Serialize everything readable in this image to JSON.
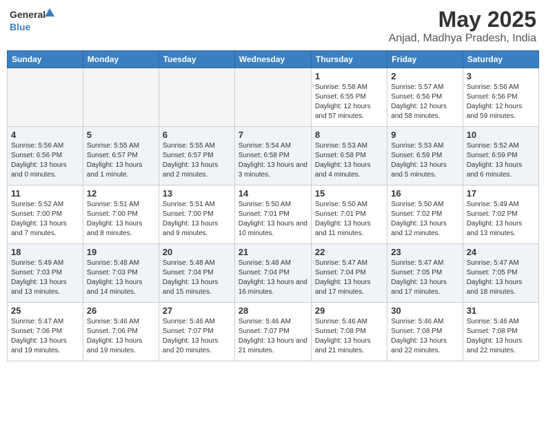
{
  "logo": {
    "general": "General",
    "blue": "Blue"
  },
  "header": {
    "month_year": "May 2025",
    "location": "Anjad, Madhya Pradesh, India"
  },
  "weekdays": [
    "Sunday",
    "Monday",
    "Tuesday",
    "Wednesday",
    "Thursday",
    "Friday",
    "Saturday"
  ],
  "weeks": [
    {
      "days": [
        {
          "num": "",
          "detail": ""
        },
        {
          "num": "",
          "detail": ""
        },
        {
          "num": "",
          "detail": ""
        },
        {
          "num": "",
          "detail": ""
        },
        {
          "num": "1",
          "detail": "Sunrise: 5:58 AM\nSunset: 6:55 PM\nDaylight: 12 hours\nand 57 minutes."
        },
        {
          "num": "2",
          "detail": "Sunrise: 5:57 AM\nSunset: 6:56 PM\nDaylight: 12 hours\nand 58 minutes."
        },
        {
          "num": "3",
          "detail": "Sunrise: 5:56 AM\nSunset: 6:56 PM\nDaylight: 12 hours\nand 59 minutes."
        }
      ]
    },
    {
      "days": [
        {
          "num": "4",
          "detail": "Sunrise: 5:56 AM\nSunset: 6:56 PM\nDaylight: 13 hours\nand 0 minutes."
        },
        {
          "num": "5",
          "detail": "Sunrise: 5:55 AM\nSunset: 6:57 PM\nDaylight: 13 hours\nand 1 minute."
        },
        {
          "num": "6",
          "detail": "Sunrise: 5:55 AM\nSunset: 6:57 PM\nDaylight: 13 hours\nand 2 minutes."
        },
        {
          "num": "7",
          "detail": "Sunrise: 5:54 AM\nSunset: 6:58 PM\nDaylight: 13 hours\nand 3 minutes."
        },
        {
          "num": "8",
          "detail": "Sunrise: 5:53 AM\nSunset: 6:58 PM\nDaylight: 13 hours\nand 4 minutes."
        },
        {
          "num": "9",
          "detail": "Sunrise: 5:53 AM\nSunset: 6:59 PM\nDaylight: 13 hours\nand 5 minutes."
        },
        {
          "num": "10",
          "detail": "Sunrise: 5:52 AM\nSunset: 6:59 PM\nDaylight: 13 hours\nand 6 minutes."
        }
      ]
    },
    {
      "days": [
        {
          "num": "11",
          "detail": "Sunrise: 5:52 AM\nSunset: 7:00 PM\nDaylight: 13 hours\nand 7 minutes."
        },
        {
          "num": "12",
          "detail": "Sunrise: 5:51 AM\nSunset: 7:00 PM\nDaylight: 13 hours\nand 8 minutes."
        },
        {
          "num": "13",
          "detail": "Sunrise: 5:51 AM\nSunset: 7:00 PM\nDaylight: 13 hours\nand 9 minutes."
        },
        {
          "num": "14",
          "detail": "Sunrise: 5:50 AM\nSunset: 7:01 PM\nDaylight: 13 hours\nand 10 minutes."
        },
        {
          "num": "15",
          "detail": "Sunrise: 5:50 AM\nSunset: 7:01 PM\nDaylight: 13 hours\nand 11 minutes."
        },
        {
          "num": "16",
          "detail": "Sunrise: 5:50 AM\nSunset: 7:02 PM\nDaylight: 13 hours\nand 12 minutes."
        },
        {
          "num": "17",
          "detail": "Sunrise: 5:49 AM\nSunset: 7:02 PM\nDaylight: 13 hours\nand 13 minutes."
        }
      ]
    },
    {
      "days": [
        {
          "num": "18",
          "detail": "Sunrise: 5:49 AM\nSunset: 7:03 PM\nDaylight: 13 hours\nand 13 minutes."
        },
        {
          "num": "19",
          "detail": "Sunrise: 5:48 AM\nSunset: 7:03 PM\nDaylight: 13 hours\nand 14 minutes."
        },
        {
          "num": "20",
          "detail": "Sunrise: 5:48 AM\nSunset: 7:04 PM\nDaylight: 13 hours\nand 15 minutes."
        },
        {
          "num": "21",
          "detail": "Sunrise: 5:48 AM\nSunset: 7:04 PM\nDaylight: 13 hours\nand 16 minutes."
        },
        {
          "num": "22",
          "detail": "Sunrise: 5:47 AM\nSunset: 7:04 PM\nDaylight: 13 hours\nand 17 minutes."
        },
        {
          "num": "23",
          "detail": "Sunrise: 5:47 AM\nSunset: 7:05 PM\nDaylight: 13 hours\nand 17 minutes."
        },
        {
          "num": "24",
          "detail": "Sunrise: 5:47 AM\nSunset: 7:05 PM\nDaylight: 13 hours\nand 18 minutes."
        }
      ]
    },
    {
      "days": [
        {
          "num": "25",
          "detail": "Sunrise: 5:47 AM\nSunset: 7:06 PM\nDaylight: 13 hours\nand 19 minutes."
        },
        {
          "num": "26",
          "detail": "Sunrise: 5:46 AM\nSunset: 7:06 PM\nDaylight: 13 hours\nand 19 minutes."
        },
        {
          "num": "27",
          "detail": "Sunrise: 5:46 AM\nSunset: 7:07 PM\nDaylight: 13 hours\nand 20 minutes."
        },
        {
          "num": "28",
          "detail": "Sunrise: 5:46 AM\nSunset: 7:07 PM\nDaylight: 13 hours\nand 21 minutes."
        },
        {
          "num": "29",
          "detail": "Sunrise: 5:46 AM\nSunset: 7:08 PM\nDaylight: 13 hours\nand 21 minutes."
        },
        {
          "num": "30",
          "detail": "Sunrise: 5:46 AM\nSunset: 7:08 PM\nDaylight: 13 hours\nand 22 minutes."
        },
        {
          "num": "31",
          "detail": "Sunrise: 5:46 AM\nSunset: 7:08 PM\nDaylight: 13 hours\nand 22 minutes."
        }
      ]
    }
  ]
}
